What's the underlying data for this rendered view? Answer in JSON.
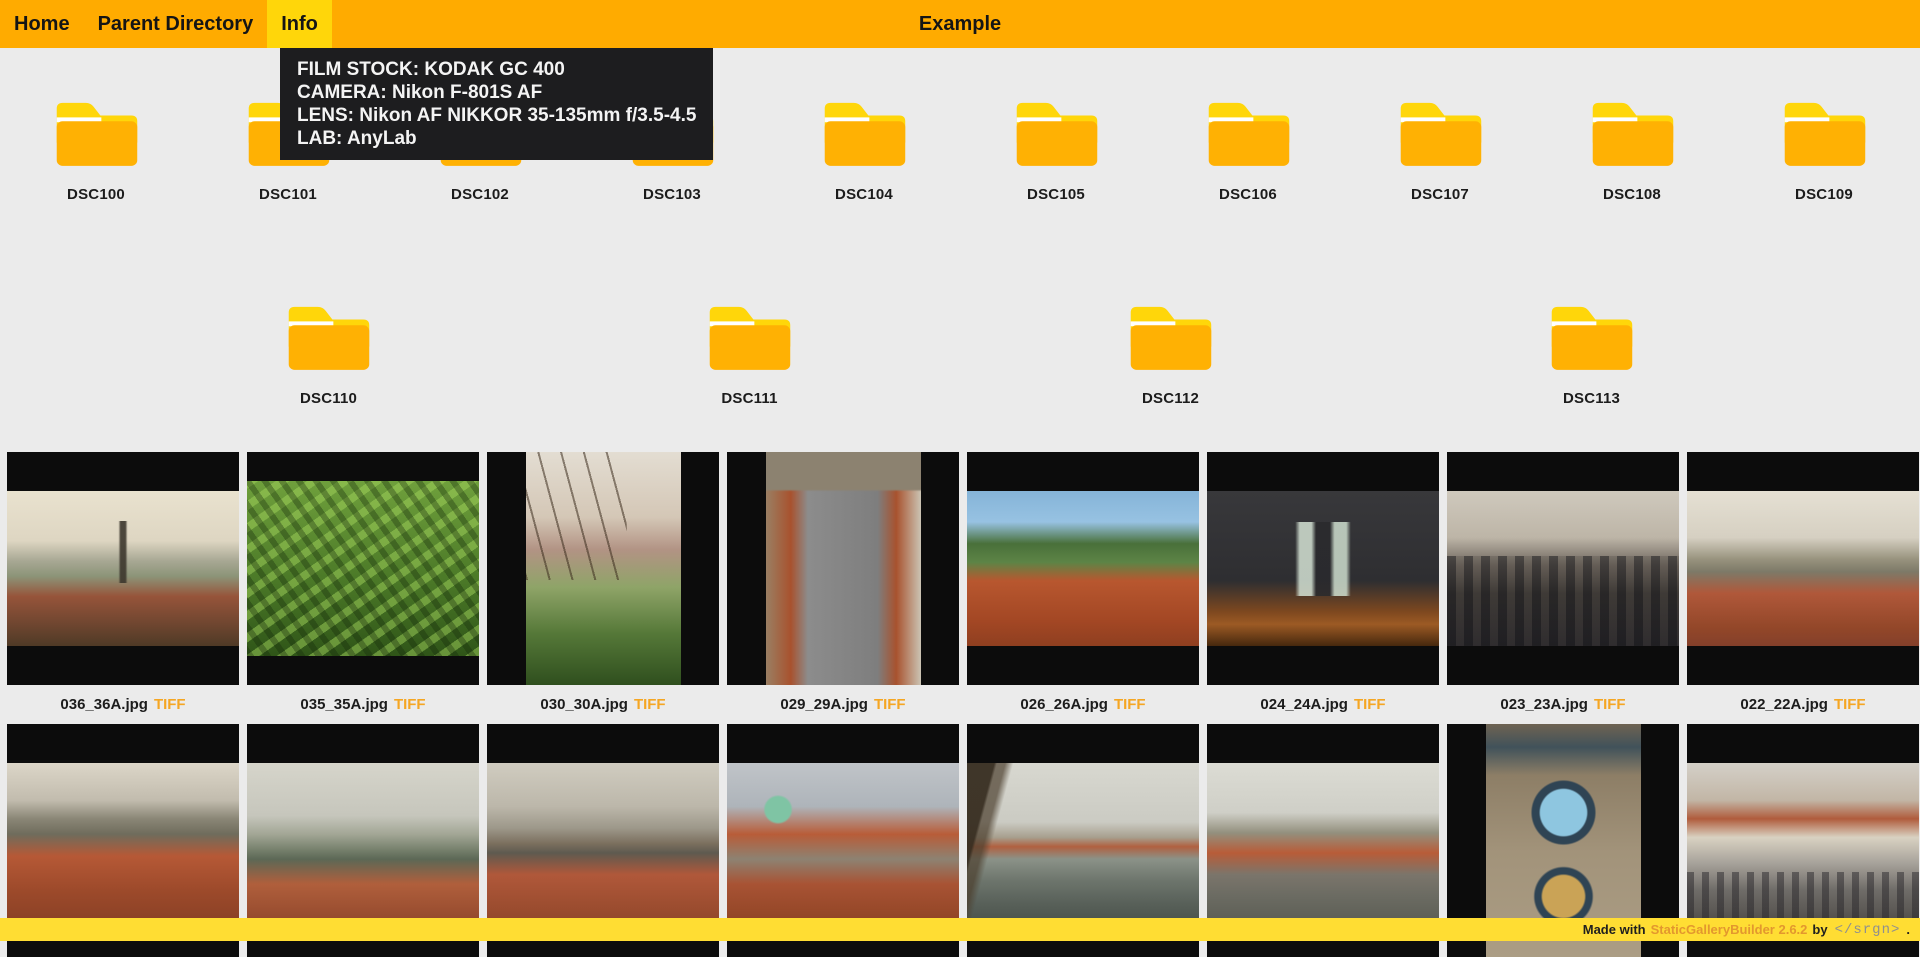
{
  "nav": {
    "items": [
      {
        "label": "Home",
        "active": false
      },
      {
        "label": "Parent Directory",
        "active": false
      },
      {
        "label": "Info",
        "active": true
      }
    ],
    "title": "Example"
  },
  "info_panel": {
    "lines": [
      "FILM STOCK: KODAK GC 400",
      "CAMERA: Nikon F-801S AF",
      "LENS: Nikon AF NIKKOR 35-135mm f/3.5-4.5",
      "LAB: AnyLab"
    ]
  },
  "folders": {
    "row1": [
      "DSC100",
      "DSC101",
      "DSC102",
      "DSC103",
      "DSC104",
      "DSC105",
      "DSC106",
      "DSC107",
      "DSC108",
      "DSC109"
    ],
    "row2": [
      "DSC110",
      "DSC111",
      "DSC112",
      "DSC113"
    ]
  },
  "gallery": {
    "row1": [
      {
        "filename": "036_36A.jpg",
        "tag": "TIFF",
        "scene": "city-spire",
        "orientation": "landscape"
      },
      {
        "filename": "035_35A.jpg",
        "tag": "TIFF",
        "scene": "foliage",
        "orientation": "landscape-tall"
      },
      {
        "filename": "030_30A.jpg",
        "tag": "TIFF",
        "scene": "trees-over-city",
        "orientation": "portrait"
      },
      {
        "filename": "029_29A.jpg",
        "tag": "TIFF",
        "scene": "aerial-square",
        "orientation": "portrait"
      },
      {
        "filename": "026_26A.jpg",
        "tag": "TIFF",
        "scene": "roofs-hill",
        "orientation": "landscape"
      },
      {
        "filename": "024_24A.jpg",
        "tag": "TIFF",
        "scene": "night-towers",
        "orientation": "landscape"
      },
      {
        "filename": "023_23A.jpg",
        "tag": "TIFF",
        "scene": "bridge-crowd",
        "orientation": "landscape"
      },
      {
        "filename": "022_22A.jpg",
        "tag": "TIFF",
        "scene": "castle-panorama",
        "orientation": "landscape"
      }
    ],
    "row2": [
      {
        "scene": "castle-roofs",
        "orientation": "landscape"
      },
      {
        "scene": "foggy-river",
        "orientation": "landscape"
      },
      {
        "scene": "city-bridge",
        "orientation": "landscape"
      },
      {
        "scene": "roofs-dome",
        "orientation": "landscape"
      },
      {
        "scene": "bridge-statue",
        "orientation": "landscape"
      },
      {
        "scene": "river-castle",
        "orientation": "landscape"
      },
      {
        "scene": "astro-clock",
        "orientation": "portrait"
      },
      {
        "scene": "square-crowd",
        "orientation": "landscape"
      }
    ]
  },
  "footer": {
    "made_with": "Made with",
    "builder": "StaticGalleryBuilder 2.6.2",
    "by": "by",
    "brand": "</srgn>",
    "suffix": "."
  },
  "colors": {
    "nav_bg": "#ffab00",
    "active_tab_bg": "#ffd60a",
    "tooltip_bg": "#1d1d1f",
    "page_bg": "#ebebeb",
    "folder_body": "#ffb103",
    "folder_tab": "#ffd60a",
    "accent": "#f5a623",
    "footer_bg": "#ffdd33",
    "thumb_bg": "#0c0c0c"
  }
}
